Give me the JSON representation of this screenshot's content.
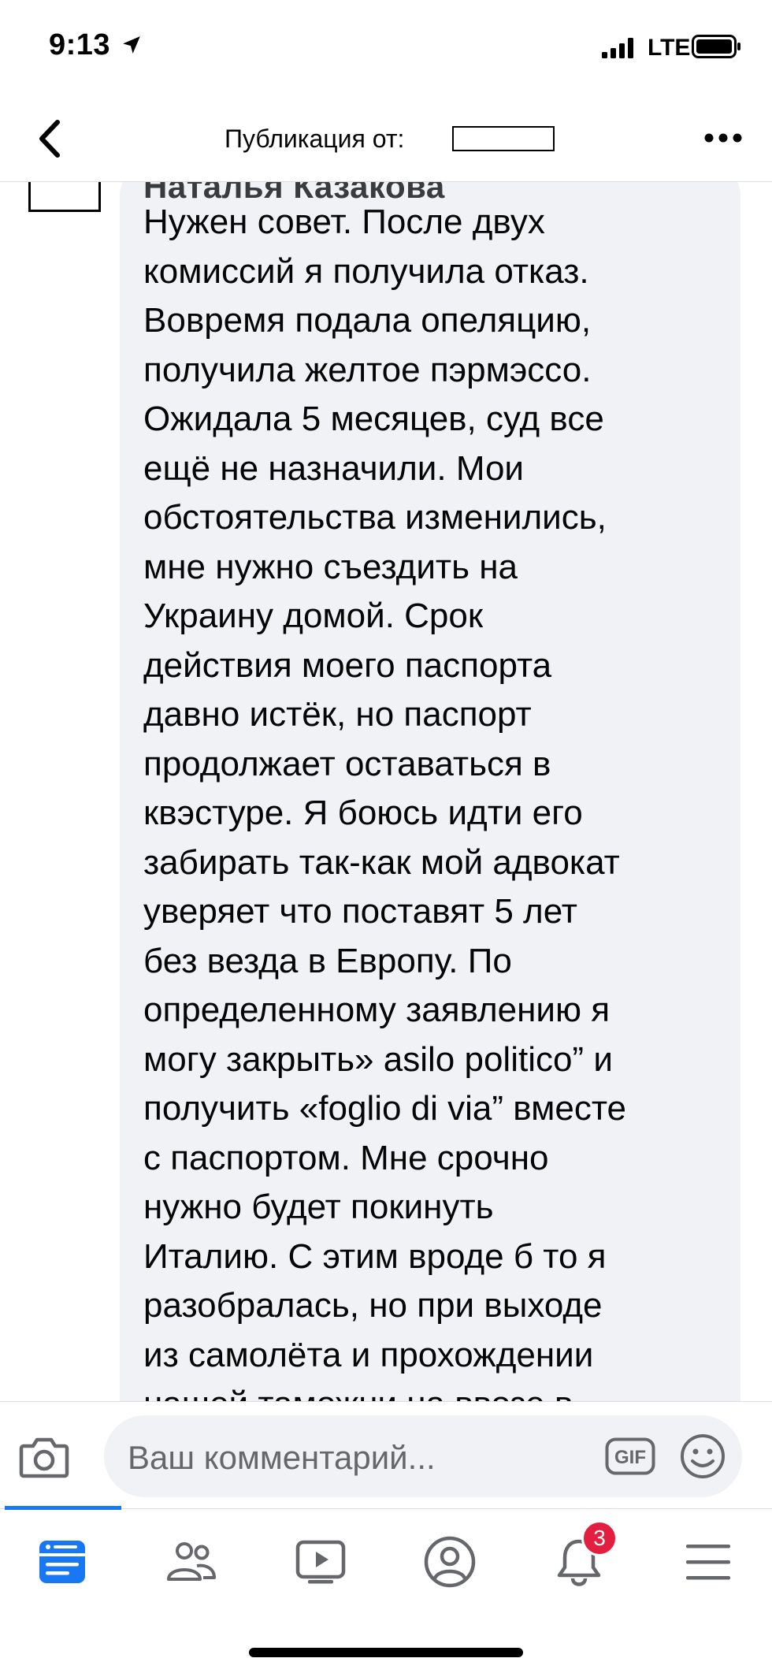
{
  "status_bar": {
    "time": "9:13",
    "network": "LTE"
  },
  "header": {
    "title": "Публикация от:",
    "icons": [
      "chevron-left-icon",
      "more-horizontal-icon"
    ]
  },
  "comment": {
    "author_peek": "Наталья Казакова",
    "text": "Нужен совет. После двух\nкомиссий я получила отказ.\nВовремя подала опеляцию,\nполучила желтое пэрмэссо.\nОжидала 5 месяцев, суд все\nещё не назначили. Мои\nобстоятельства изменились,\nмне нужно съездить на\nУкраину домой. Срок\nдействия моего паспорта\nдавно истёк, но паспорт\nпродолжает оставаться в\nквэстуре. Я боюсь идти его\nзабирать так-как мой адвокат\nуверяет что поставят 5 лет\nбез везда в Европу. По\nопределенному заявлению я\nмогу закрыть» asilo politico” и\nполучить «foglio di via” вместе\nс паспортом. Мне срочно\nнужно будет покинуть\nИталию. С этим вроде б то я\nразобралась, но при выходе\nиз самолёта и прохождении\nнашей таможни на ввозе в"
  },
  "composer": {
    "placeholder": "Ваш комментарий...",
    "gif_label": "GIF"
  },
  "tabbar": {
    "tabs": [
      "news-feed-icon",
      "groups-icon",
      "watch-icon",
      "profile-icon",
      "notifications-icon",
      "menu-icon"
    ],
    "notification_count": "3",
    "active_color": "#1877f2"
  },
  "colors": {
    "accent": "#1877f2",
    "badge": "#e41e3f",
    "bubble": "#f0f2f5"
  }
}
